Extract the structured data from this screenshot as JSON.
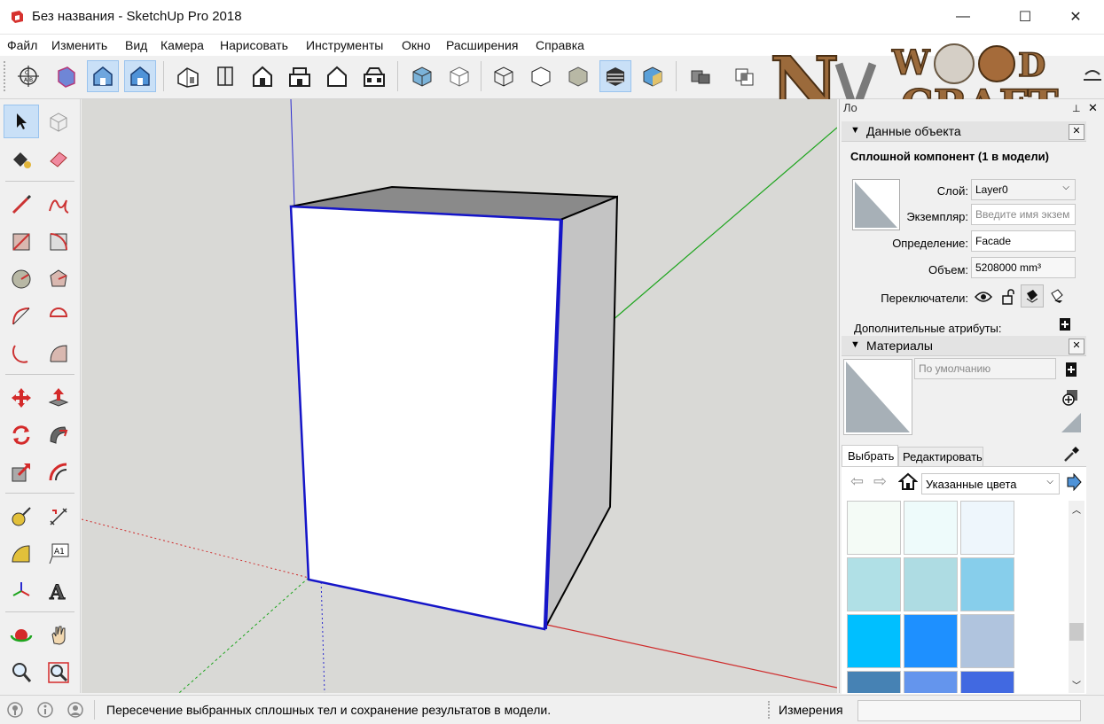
{
  "window": {
    "title": "Без названия - SketchUp Pro 2018",
    "minimize": "—",
    "maximize": "☐",
    "close": "✕"
  },
  "menu": [
    "Файл",
    "Изменить",
    "Вид",
    "Камера",
    "Нарисовать",
    "Инструменты",
    "Окно",
    "Расширения",
    "Справка"
  ],
  "watermark": "NV WOOD CRAFT",
  "toolbar": {
    "icons": [
      "standard-views-icon",
      "x-ray-icon",
      "back-edges-icon",
      "wireframe-icon",
      "iso-view-icon",
      "top-view-icon",
      "front-view-icon",
      "right-view-icon",
      "back-view-icon",
      "left-view-icon",
      "hidden-line-icon",
      "shaded-icon",
      "textured-icon",
      "monochrome-icon",
      "solid-union-icon",
      "solid-intersect-icon"
    ],
    "partial_title": "Ло"
  },
  "lefttools": {
    "icons": [
      "select-icon",
      "make-component-icon",
      "paint-bucket-icon",
      "eraser-icon",
      "line-icon",
      "freehand-icon",
      "rectangle-icon",
      "rotated-rectangle-icon",
      "circle-icon",
      "polygon-icon",
      "arc-icon",
      "pie-icon",
      "two-point-arc-icon",
      "three-point-arc-icon",
      "move-icon",
      "push-pull-icon",
      "rotate-icon",
      "follow-me-icon",
      "scale-icon",
      "offset-icon",
      "tape-measure-icon",
      "dimension-icon",
      "protractor-icon",
      "text-icon",
      "axes-icon",
      "3d-text-icon",
      "orbit-icon",
      "pan-icon",
      "zoom-icon",
      "zoom-window-icon"
    ]
  },
  "entity_info": {
    "header": "Данные объекта",
    "type": "Сплошной компонент (1 в модели)",
    "layer_label": "Слой:",
    "layer_value": "Layer0",
    "instance_label": "Экземпляр:",
    "instance_placeholder": "Введите имя экзем",
    "definition_label": "Определение:",
    "definition_value": "Facade",
    "volume_label": "Объем:",
    "volume_value": "5208000 mm³",
    "toggles_label": "Переключатели:",
    "advanced_label": "Дополнительные атрибуты:"
  },
  "materials": {
    "header": "Материалы",
    "name_value": "По умолчанию",
    "tab_select": "Выбрать",
    "tab_edit": "Редактировать",
    "collection": "Указанные цвета",
    "swatches": [
      "#f4fbf6",
      "#eefbfb",
      "#eef6fc",
      "#b0e0e6",
      "#aedce3",
      "#87ceeb",
      "#00bfff",
      "#1e90ff",
      "#b0c4de",
      "#4682b4",
      "#6495ed",
      "#4169e1"
    ]
  },
  "status": {
    "hint": "Пересечение выбранных сплошных тел и сохранение результатов в модели.",
    "measure_label": "Измерения",
    "measure_value": ""
  }
}
